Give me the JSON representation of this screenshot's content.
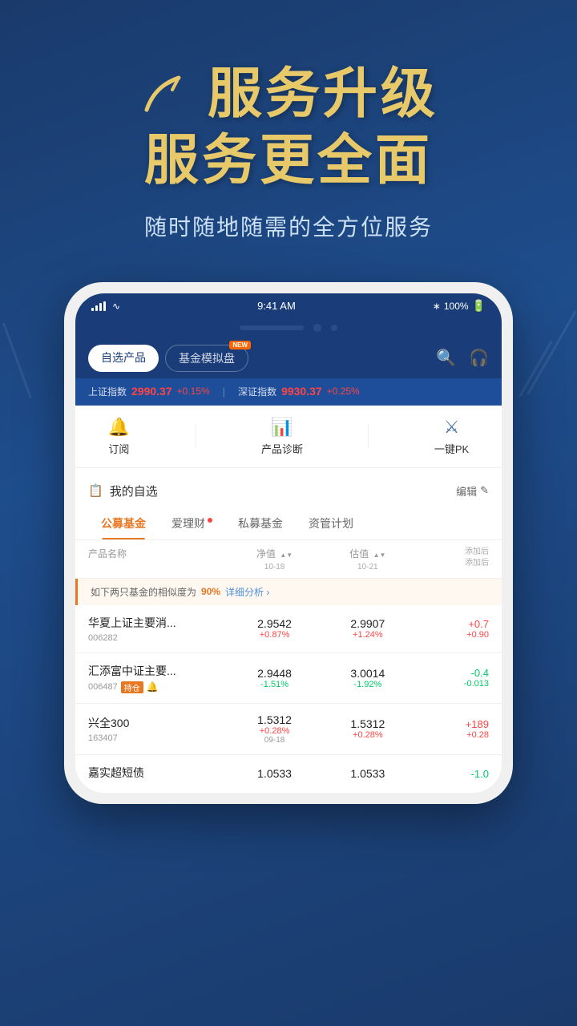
{
  "hero": {
    "line1": "服务升级",
    "line2": "服务更全面",
    "subtitle": "随时随地随需的全方位服务"
  },
  "status_bar": {
    "time": "9:41 AM",
    "battery": "100%"
  },
  "tabs": {
    "tab1": "自选产品",
    "tab2": "基金模拟盘",
    "new_badge": "NEW"
  },
  "market": {
    "sh_label": "上证指数",
    "sh_value": "2990.37",
    "sh_change": "+0.15%",
    "sz_label": "深证指数",
    "sz_value": "9930.37",
    "sz_change": "+0.25%"
  },
  "functions": {
    "subscribe_icon": "🔔",
    "subscribe_label": "订阅",
    "diagnose_icon": "📊",
    "diagnose_label": "产品诊断",
    "pk_icon": "⚔",
    "pk_label": "一键PK"
  },
  "watchlist": {
    "title": "我的自选",
    "icon": "📋",
    "edit_label": "编辑"
  },
  "categories": [
    {
      "label": "公募基金",
      "active": true,
      "dot": false
    },
    {
      "label": "爱理财",
      "active": false,
      "dot": true
    },
    {
      "label": "私募基金",
      "active": false,
      "dot": false
    },
    {
      "label": "资管计划",
      "active": false,
      "dot": false
    }
  ],
  "table_header": {
    "name": "产品名称",
    "nav": "净值",
    "nav_date": "10-18",
    "est": "估值",
    "est_date": "10-21",
    "add": "添加后\n添加后"
  },
  "similarity": {
    "text": "如下两只基金的相似度为",
    "pct": "90%",
    "link": "详细分析 ›"
  },
  "funds": [
    {
      "name": "华夏上证主要消...",
      "code": "006282",
      "hold_badge": "",
      "bell": false,
      "nav": "2.9542",
      "nav_change": "+0.87%",
      "est": "2.9907",
      "est_change": "+1.24%",
      "change": "+0.7",
      "change2": "+0.90"
    },
    {
      "name": "汇添富中证主要...",
      "code": "006487",
      "hold_badge": "持仓",
      "bell": true,
      "nav": "2.9448",
      "nav_change": "-1.51%",
      "est": "3.0014",
      "est_change": "-1.92%",
      "change": "-0.4",
      "change2": "-0.013"
    },
    {
      "name": "兴全300",
      "code": "163407",
      "hold_badge": "",
      "bell": false,
      "nav": "1.5312",
      "nav_change": "+0.28%",
      "nav_date": "09-18",
      "est": "1.5312",
      "est_change": "+0.28%",
      "change": "+189",
      "change2": "+0.28"
    },
    {
      "name": "嘉实超短债",
      "code": "",
      "hold_badge": "",
      "bell": false,
      "nav": "1.0533",
      "nav_change": "",
      "est": "1.0533",
      "est_change": "",
      "change": "-1.0",
      "change2": ""
    }
  ]
}
